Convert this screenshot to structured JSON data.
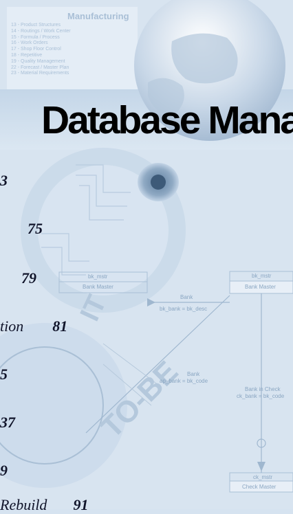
{
  "title": "Database Mana",
  "manufacturing": {
    "heading": "Manufacturing",
    "items": [
      "13 - Product Structures",
      "14 - Routings / Work Center",
      "15 - Formula / Process",
      "16 - Work Orders",
      "17 - Shop Floor Control",
      "18 - Repetitive",
      "19 - Quality Management",
      "22 - Forecast / Master Plan",
      "23 - Material Requirements"
    ]
  },
  "diagram": {
    "bank_master_table": "bk_mstr",
    "bank_master": "Bank Master",
    "bank_master_2": "Bank Master",
    "bank_master_2_table": "bk_mstr",
    "bank_link": "Bank",
    "bank_link_key": "bk_bank = bk_desc",
    "bank_in_check": "Bank in Check",
    "bank_in_check_key": "ck_bank = bk_code",
    "bank_key_left": "Bank",
    "bank_key_left_detail": "ap_bank = bk_code",
    "check_master_table": "ck_mstr",
    "check_master": "Check Master"
  },
  "toc": [
    {
      "text": "",
      "page": "3"
    },
    {
      "text": "",
      "page": "75"
    },
    {
      "text": "",
      "page": "79"
    },
    {
      "text": "tion",
      "page": "81"
    },
    {
      "text": "",
      "page": "5"
    },
    {
      "text": "",
      "page": "37"
    },
    {
      "text": "",
      "page": "9"
    },
    {
      "text": "Rebuild",
      "page": "91"
    }
  ]
}
